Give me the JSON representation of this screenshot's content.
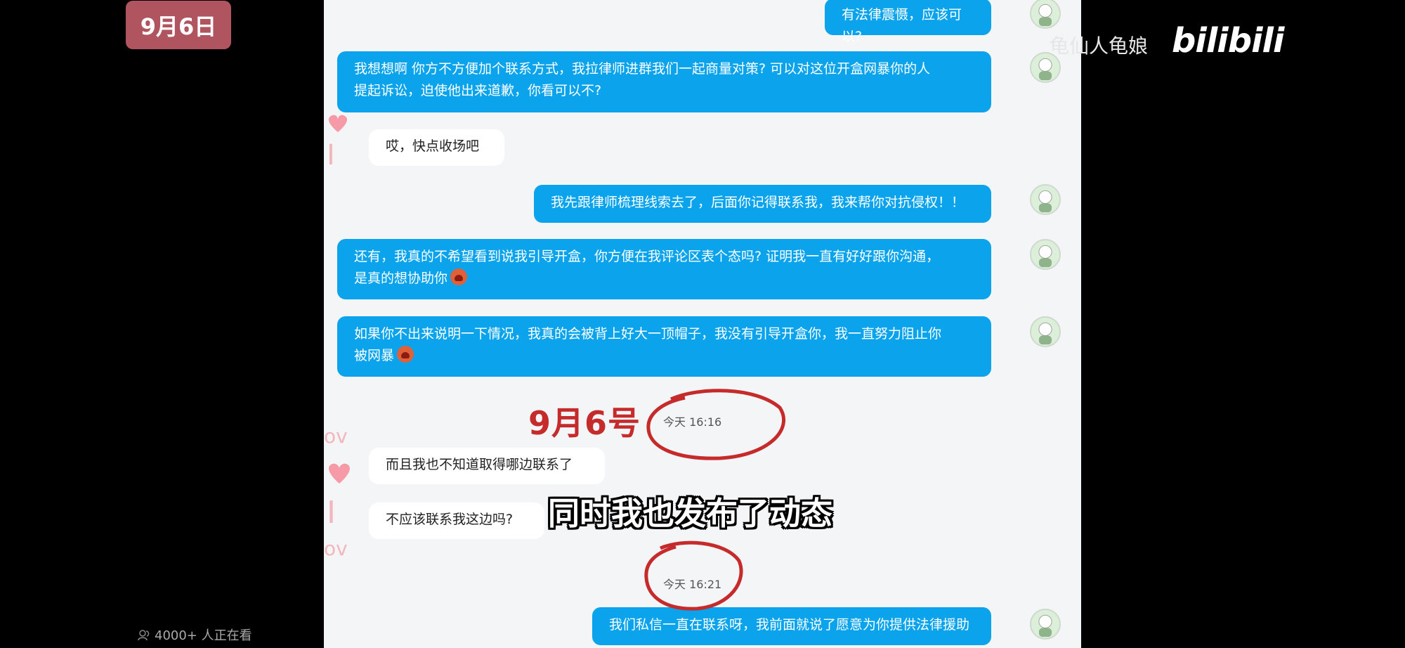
{
  "date_badge": "9月6日",
  "watermark": {
    "uploader": "龟仙人龟娘",
    "logo": "bilibili"
  },
  "viewers": "4000+ 人正在看",
  "subtitle": "同时我也发布了动态",
  "annotation": "9月6号",
  "messages": [
    {
      "side": "out",
      "text": "有法律震慑，应该可以?"
    },
    {
      "side": "out",
      "line1": "我想想啊   你方不方便加个联系方式，我拉律师进群我们一起商量对策? 可以对这位开盒网暴你的人",
      "line2": "提起诉讼，迫使他出来道歉，你看可以不?"
    },
    {
      "side": "in",
      "text": "哎，快点收场吧"
    },
    {
      "side": "out",
      "text": "我先跟律师梳理线索去了，后面你记得联系我，我来帮你对抗侵权！！"
    },
    {
      "side": "out",
      "line1": "还有，我真的不希望看到说我引导开盒，你方便在我评论区表个态吗? 证明我一直有好好跟你沟通，",
      "line2": "是真的想协助你"
    },
    {
      "side": "out",
      "line1": "如果你不出来说明一下情况，我真的会被背上好大一顶帽子，我没有引导开盒你，我一直努力阻止你",
      "line2": "被网暴"
    },
    {
      "side": "in",
      "text": "而且我也不知道取得哪边联系了"
    },
    {
      "side": "in",
      "text": "不应该联系我这边吗?"
    },
    {
      "side": "out",
      "text": "我们私信一直在联系呀，我前面就说了愿意为你提供法律援助"
    }
  ],
  "timestamps": [
    "今天 16:16",
    "今天 16:21"
  ],
  "colors": {
    "bubble_out": "#0aa3ec",
    "badge": "#b0555f",
    "annotation_red": "#c62b2b"
  }
}
